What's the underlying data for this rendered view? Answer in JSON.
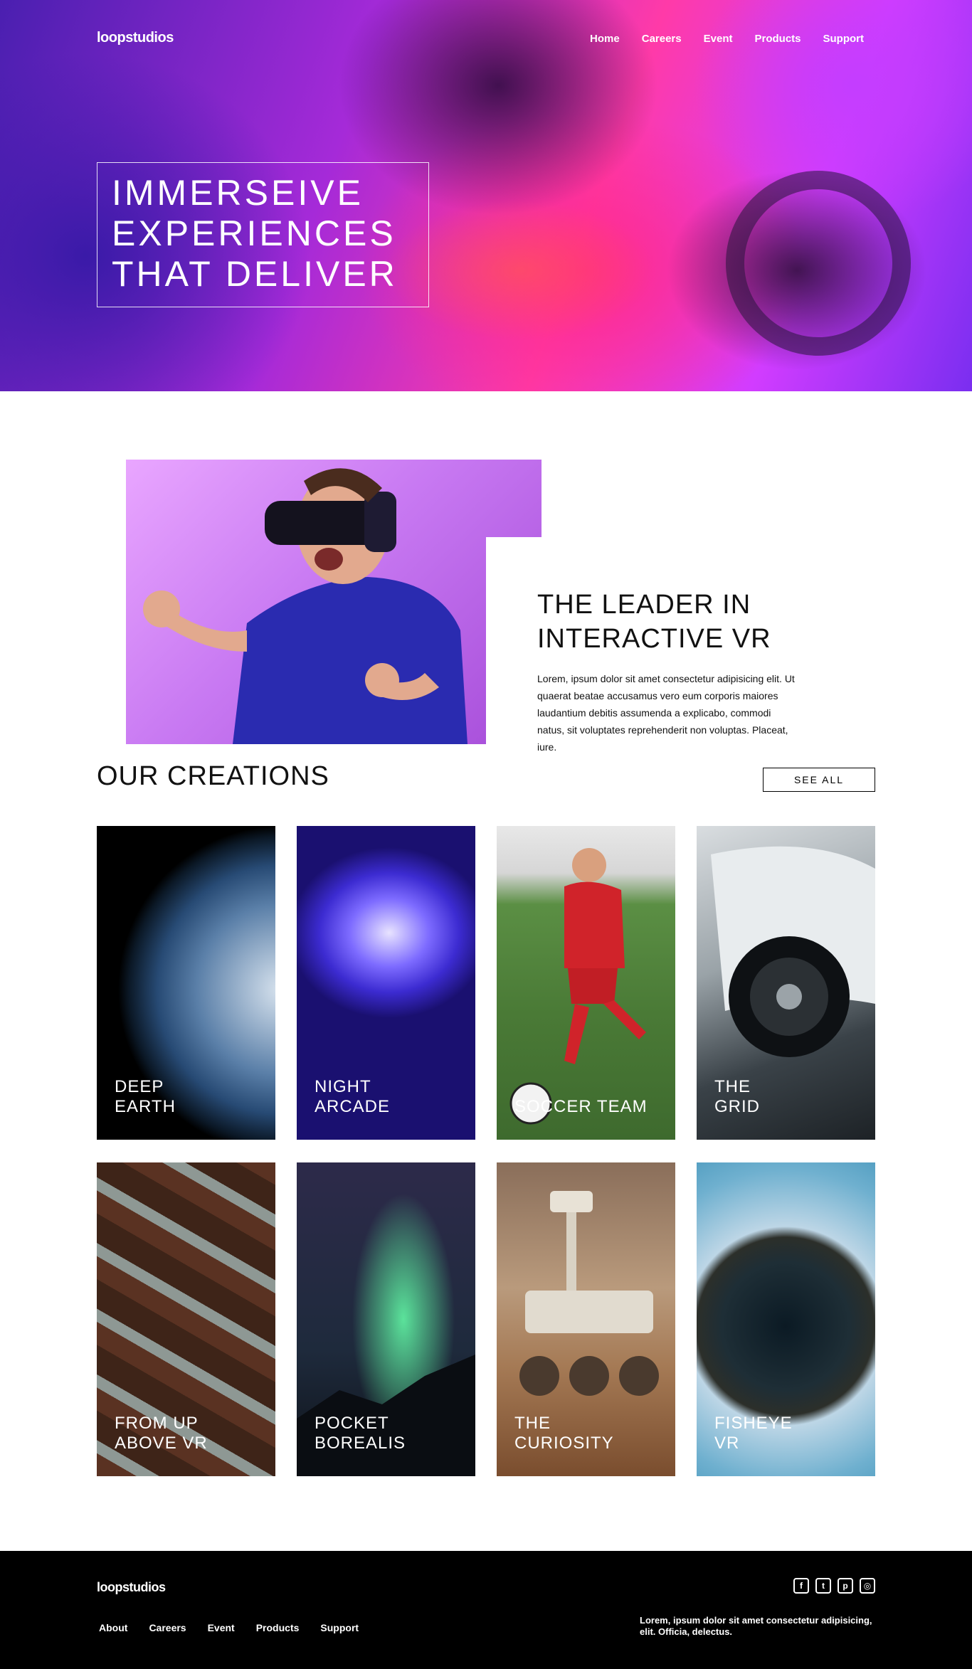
{
  "header": {
    "logo": "loopstudios",
    "nav": [
      "Home",
      "Careers",
      "Event",
      "Products",
      "Support"
    ]
  },
  "hero": {
    "title_lines": [
      "IMMERSEIVE",
      "EXPERIENCES",
      "THAT DELIVER"
    ]
  },
  "intro": {
    "title_lines": [
      "THE LEADER IN",
      "INTERACTIVE VR"
    ],
    "body": "Lorem, ipsum dolor sit amet consectetur adipisicing elit. Ut quaerat beatae accusamus vero eum corporis maiores laudantium debitis assumenda a explicabo, commodi natus, sit voluptates reprehenderit non voluptas. Placeat, iure."
  },
  "creations": {
    "title": "OUR CREATIONS",
    "see_all": "SEE ALL",
    "cards": [
      {
        "label": "DEEP\nEARTH"
      },
      {
        "label": "NIGHT\nARCADE"
      },
      {
        "label": "SOCCER TEAM"
      },
      {
        "label": "THE\nGRID"
      },
      {
        "label": "FROM UP\nABOVE VR"
      },
      {
        "label": "POCKET\nBOREALIS"
      },
      {
        "label": "THE\nCURIOSITY"
      },
      {
        "label": "FISHEYE\nVR"
      }
    ]
  },
  "footer": {
    "logo": "loopstudios",
    "nav": [
      "About",
      "Careers",
      "Event",
      "Products",
      "Support"
    ],
    "socials": [
      {
        "icon": "facebook-icon",
        "glyph": "f"
      },
      {
        "icon": "twitter-icon",
        "glyph": "t"
      },
      {
        "icon": "pinterest-icon",
        "glyph": "p"
      },
      {
        "icon": "instagram-icon",
        "glyph": "◎"
      }
    ],
    "text": "Lorem, ipsum dolor sit amet consectetur adipisicing, elit. Officia, delectus."
  }
}
